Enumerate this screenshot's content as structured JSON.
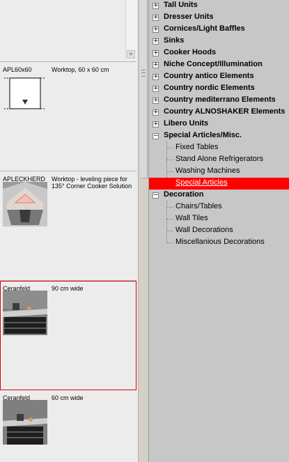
{
  "catalog": {
    "items": [
      {
        "code": "APL60x60",
        "description": "Worktop, 60 x 60 cm"
      },
      {
        "code": "APLECKHERD",
        "description": "Worktop - leveling piece for 135° Corner Cooker Solution"
      },
      {
        "code": "Ceranfeld",
        "description": "90 cm wide"
      },
      {
        "code": "Ceranfeld",
        "description": "60 cm wide"
      }
    ]
  },
  "tree": {
    "categories": [
      {
        "label": "Tall Units",
        "expander": "+"
      },
      {
        "label": "Dresser Units",
        "expander": "+"
      },
      {
        "label": "Cornices/Light Baffles",
        "expander": "+"
      },
      {
        "label": "Sinks",
        "expander": "+"
      },
      {
        "label": "Cooker Hoods",
        "expander": "+"
      },
      {
        "label": "Niche Concept/Illumination",
        "expander": "+"
      },
      {
        "label": "Country antico Elements",
        "expander": "+"
      },
      {
        "label": "Country nordic Elements",
        "expander": "+"
      },
      {
        "label": "Country mediterrano Elements",
        "expander": "+"
      },
      {
        "label": "Country ALNOSHAKER Elements",
        "expander": "+"
      },
      {
        "label": "Libero Units",
        "expander": "+"
      },
      {
        "label": "Special Articles/Misc.",
        "expander": "−"
      },
      {
        "label": "Decoration",
        "expander": "−"
      }
    ],
    "special_children": [
      "Fixed Tables",
      "Stand Alone Refrigerators",
      "Washing Machines",
      "Special Articles"
    ],
    "decoration_children": [
      "Chairs/Tables",
      "Wall Tiles",
      "Wall Decorations",
      "Miscellanious Decorations"
    ]
  },
  "colors": {
    "selection": "#ff0000",
    "tree_bg": "#c7c7c7",
    "catalog_bg": "#ececec"
  }
}
